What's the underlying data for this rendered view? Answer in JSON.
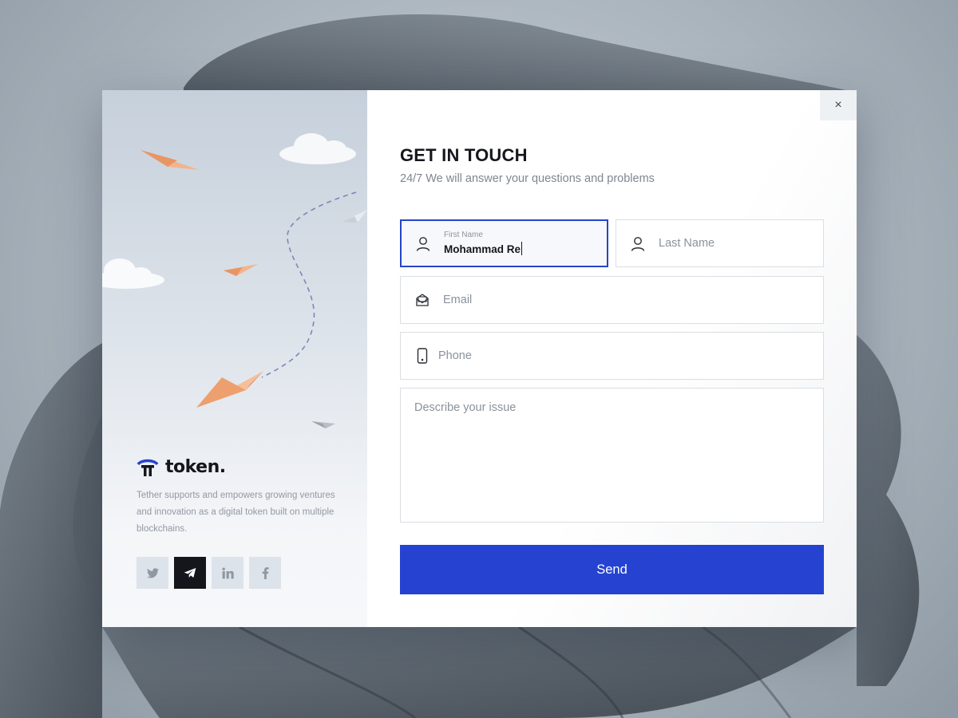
{
  "colors": {
    "accent": "#2543d0",
    "focus_border": "#2744c8",
    "dark": "#15171c",
    "muted": "#8b929c",
    "plane": "#f0a67a"
  },
  "brand": {
    "name": "token.",
    "description": "Tether supports and empowers growing ventures and innovation as a digital token built on multiple blockchains."
  },
  "socials": [
    {
      "name": "twitter",
      "icon": "twitter-icon",
      "active": false
    },
    {
      "name": "telegram",
      "icon": "telegram-icon",
      "active": true
    },
    {
      "name": "linkedin",
      "icon": "linkedin-icon",
      "active": false
    },
    {
      "name": "facebook",
      "icon": "facebook-icon",
      "active": false
    }
  ],
  "dialog": {
    "close_label": "×",
    "title": "GET IN TOUCH",
    "subtitle": "24/7  We will answer your questions and problems"
  },
  "form": {
    "first_name": {
      "label": "First Name",
      "value": "Mohammad Re",
      "icon": "user-icon",
      "focused": true
    },
    "last_name": {
      "placeholder": "Last Name",
      "icon": "user-icon"
    },
    "email": {
      "placeholder": "Email",
      "icon": "mail-icon"
    },
    "phone": {
      "placeholder": "Phone",
      "icon": "phone-icon"
    },
    "issue": {
      "placeholder": "Describe your issue"
    },
    "submit_label": "Send"
  }
}
